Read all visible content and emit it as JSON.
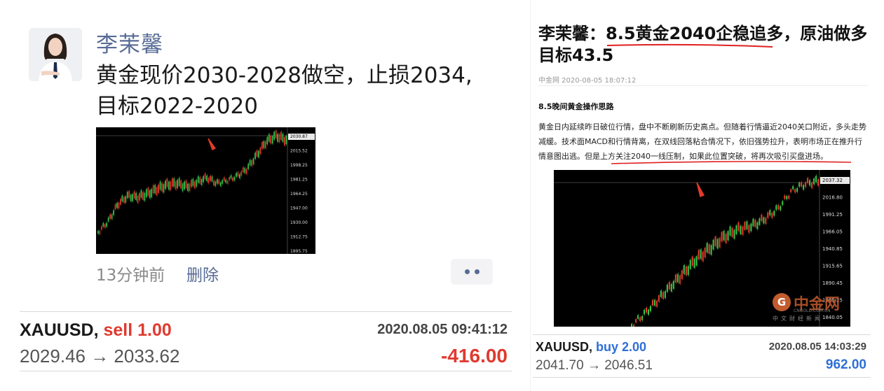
{
  "post": {
    "author": "李茉馨",
    "text_line1": "黄金现价2030-2028做空，止损2034,",
    "text_line2": "目标2022-2020",
    "time_ago": "13分钟前",
    "delete_label": "删除",
    "more_icon": "ellipsis-icon",
    "chart_axis_labels": [
      "2030.87",
      "2015.52",
      "1998.25",
      "1981.25",
      "1964.25",
      "1947.00",
      "1930.00",
      "1912.75",
      "1895.75"
    ]
  },
  "trade_left": {
    "symbol": "XAUUSD,",
    "side": "sell 1.00",
    "timestamp": "2020.08.05 09:41:12",
    "prices": "2029.46 → 2033.62",
    "pnl": "-416.00",
    "side_color": "#e03a2f",
    "pnl_color": "#e03a2f"
  },
  "article": {
    "title_prefix": "李茉馨：",
    "title_highlight": "8.5黄金2040企稳追多",
    "title_rest": "，原油做多目标43.5",
    "source": "中金网  2020-08-05 18:07:12",
    "heading": "8.5晚间黄金操作思路",
    "body_main": "黄金日内延续昨日破位行情，盘中不断刷新历史高点。但随着行情逼近2040关口附近，多头走势减缓。技术面MACD和行情背离，在双线回落粘合情况下，依旧强势拉升，表明市场正在推升行情意图出逃。",
    "body_highlight": "但是上方关注2040一线压制，如果此位置突破，将再次吸引买盘进场。",
    "chart_axis_labels": [
      "2037.32",
      "2016.80",
      "1991.25",
      "1966.05",
      "1940.85",
      "1915.65",
      "1890.45",
      "1865.25",
      "1840.05"
    ],
    "watermark_cn": "中金网",
    "watermark_url": "CNGOLD.COM.CN",
    "watermark_sub": "中文财经新闻",
    "underline_color": "#e02020"
  },
  "trade_right": {
    "symbol": "XAUUSD,",
    "side": "buy 2.00",
    "timestamp": "2020.08.05 14:03:29",
    "prices": "2041.70 → 2046.51",
    "pnl": "962.00",
    "side_color": "#2f6fd6",
    "pnl_color": "#2f6fd6"
  }
}
